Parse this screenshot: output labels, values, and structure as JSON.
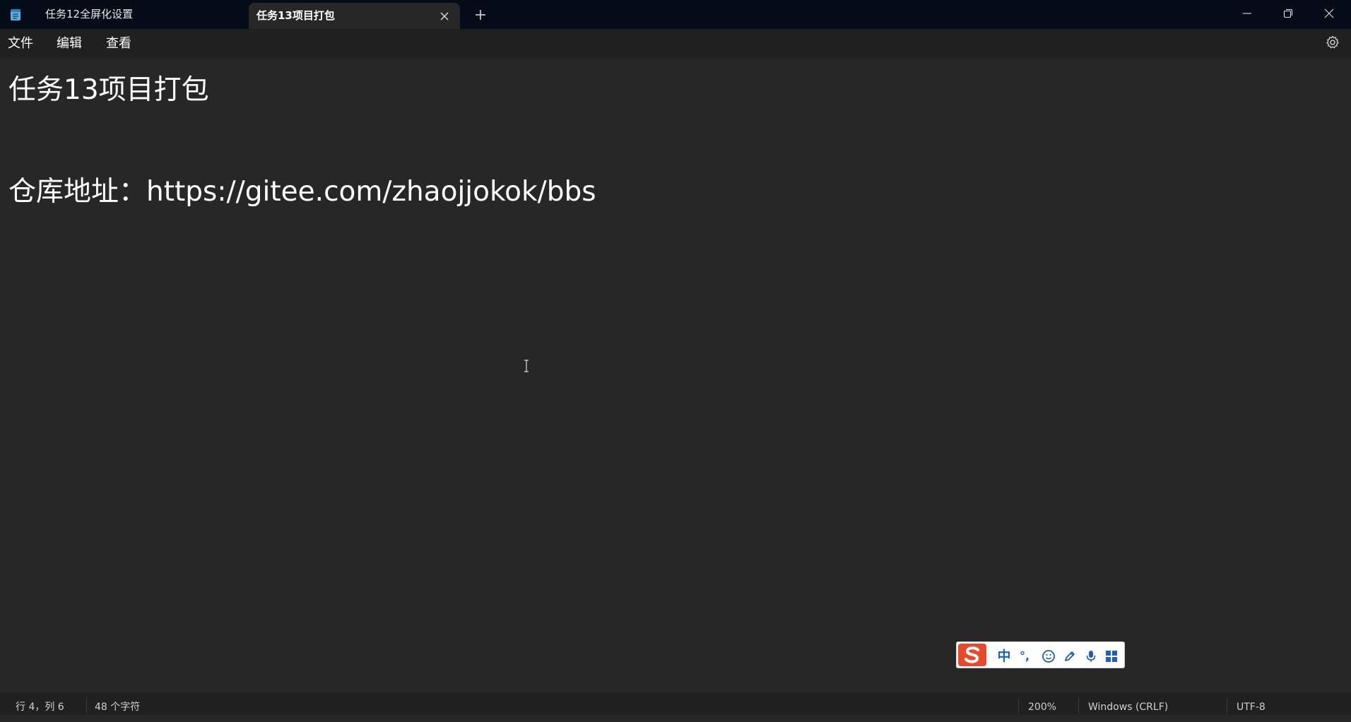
{
  "tabs": [
    {
      "label": "任务12全屏化设置",
      "active": false
    },
    {
      "label": "任务13项目打包",
      "active": true
    }
  ],
  "menu": {
    "file": "文件",
    "edit": "编辑",
    "view": "查看"
  },
  "editor": {
    "lines": [
      "任务13项目打包",
      "",
      "",
      "仓库地址：https://gitee.com/zhaojjokok/bbs"
    ]
  },
  "ime": {
    "mode": "中",
    "punct": "°,"
  },
  "status": {
    "position": "行 4，列 6",
    "char_count": "48 个字符",
    "zoom": "200%",
    "line_ending": "Windows (CRLF)",
    "encoding": "UTF-8"
  },
  "colors": {
    "editor_bg": "#272727",
    "titlebar_bg": "#040d17",
    "menubar_bg": "#202020",
    "ime_accent": "#1b5fbf",
    "ime_logo": "#e8492a"
  }
}
